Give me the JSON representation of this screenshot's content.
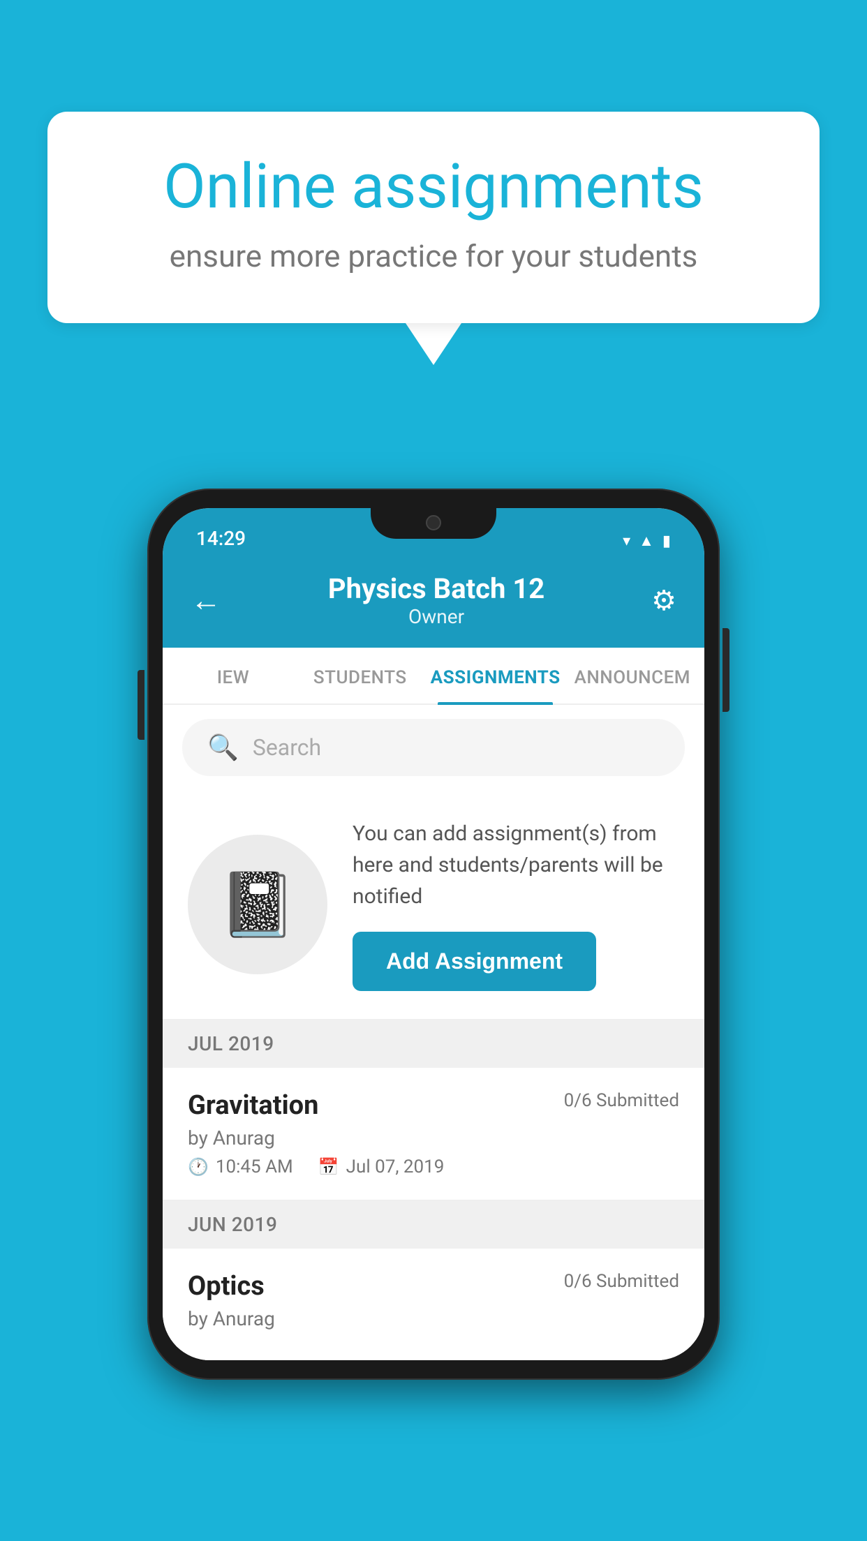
{
  "background_color": "#1ab3d8",
  "speech_bubble": {
    "title": "Online assignments",
    "subtitle": "ensure more practice for your students"
  },
  "phone": {
    "status_bar": {
      "time": "14:29",
      "icons": [
        "wifi",
        "signal",
        "battery"
      ]
    },
    "header": {
      "title": "Physics Batch 12",
      "subtitle": "Owner",
      "back_label": "←",
      "settings_label": "⚙"
    },
    "tabs": [
      {
        "label": "IEW",
        "active": false
      },
      {
        "label": "STUDENTS",
        "active": false
      },
      {
        "label": "ASSIGNMENTS",
        "active": true
      },
      {
        "label": "ANNOUNCEM",
        "active": false
      }
    ],
    "search": {
      "placeholder": "Search"
    },
    "info_section": {
      "description": "You can add assignment(s) from here and students/parents will be notified",
      "button_label": "Add Assignment"
    },
    "assignments": [
      {
        "month": "JUL 2019",
        "items": [
          {
            "name": "Gravitation",
            "status": "0/6 Submitted",
            "by": "by Anurag",
            "time": "10:45 AM",
            "date": "Jul 07, 2019"
          }
        ]
      },
      {
        "month": "JUN 2019",
        "items": [
          {
            "name": "Optics",
            "status": "0/6 Submitted",
            "by": "by Anurag",
            "time": "",
            "date": ""
          }
        ]
      }
    ]
  }
}
